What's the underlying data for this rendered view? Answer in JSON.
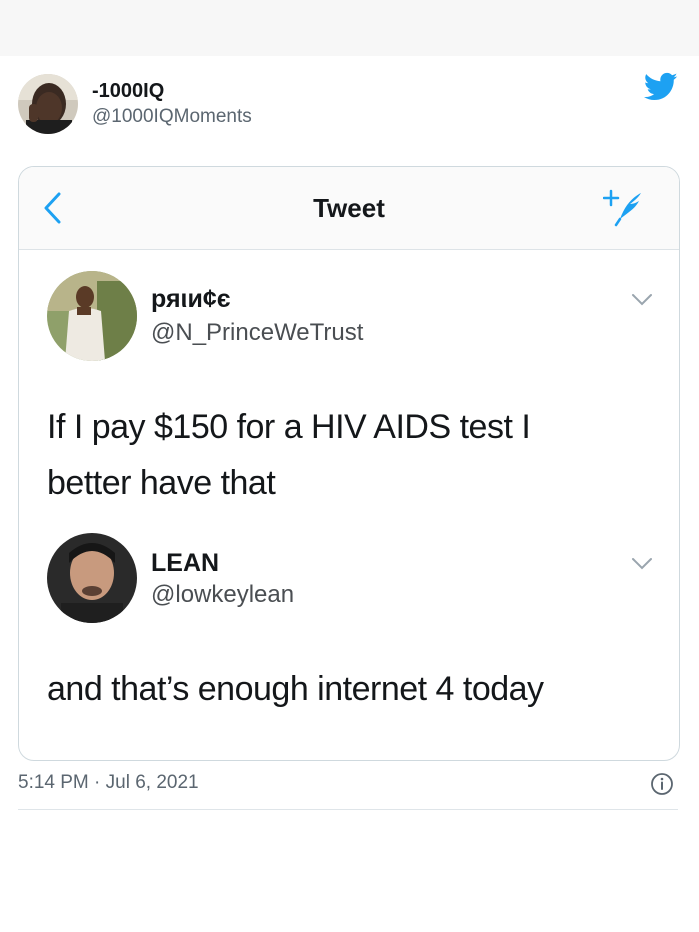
{
  "author": {
    "name": "-1000IQ",
    "handle": "@1000IQMoments"
  },
  "brand_color": "#1da1f2",
  "inner_screenshot": {
    "title": "Tweet",
    "icons": {
      "back": "chevron-left-icon",
      "compose": "compose-tweet-icon"
    },
    "tweets": [
      {
        "name": "ряιи¢є",
        "handle": "@N_PrinceWeTrust",
        "lines": [
          "If I pay $150 for a HIV AIDS test I",
          "better have that"
        ]
      },
      {
        "name": "LEAN",
        "handle": "@lowkeylean",
        "lines": [
          "and that’s enough internet 4 today"
        ]
      }
    ]
  },
  "footer": {
    "timestamp": "5:14 PM · Jul 6, 2021",
    "info_icon": "info-icon"
  }
}
